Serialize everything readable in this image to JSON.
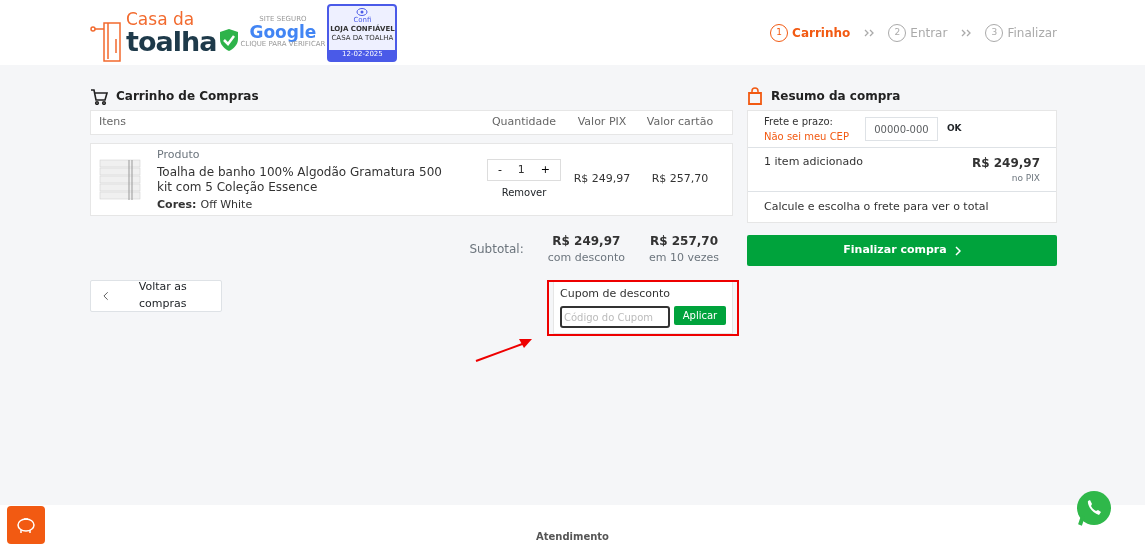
{
  "header": {
    "logo": {
      "line1": "Casa da",
      "line2": "toalha"
    },
    "google_seal": {
      "top": "SITE SEGURO",
      "brand": "Google",
      "bottom": "CLIQUE PARA VERIFICAR"
    },
    "trust_seal": {
      "brand": "Confi",
      "title": "LOJA CONFIÁVEL",
      "store": "CASA DA TOALHA",
      "date": "12-02-2025"
    },
    "steps": [
      {
        "number": "1",
        "label": "Carrinho",
        "selected": true
      },
      {
        "number": "2",
        "label": "Entrar",
        "selected": false
      },
      {
        "number": "3",
        "label": "Finalizar",
        "selected": false
      }
    ]
  },
  "cart": {
    "title": "Carrinho de Compras",
    "columns": [
      "Itens",
      "Quantidade",
      "Valor PIX",
      "Valor cartão"
    ],
    "items": [
      {
        "category": "Produto",
        "name": "Toalha de banho 100% Algodão Gramatura 500 kit com 5 Coleção Essence",
        "colors_label": "Cores:",
        "colors_value": "Off White",
        "decrement": "-",
        "quantity": "1",
        "increment": "+",
        "remove": "Remover",
        "price_pix": "R$ 249,97",
        "price_card": "R$ 257,70"
      }
    ],
    "subtotal": {
      "label": "Subtotal:",
      "pix": "R$ 249,97",
      "pix_note": "com desconto",
      "card": "R$ 257,70",
      "card_note": "em 10 vezes"
    },
    "back_button": "Voltar as compras"
  },
  "coupon": {
    "title": "Cupom de desconto",
    "placeholder": "Código do Cupom",
    "button": "Aplicar"
  },
  "summary": {
    "title": "Resumo da compra",
    "shipping_label": "Frete e prazo:",
    "cep_link": "Não sei meu CEP",
    "cep_placeholder": "00000-000",
    "ok": "OK",
    "items_count": "1 item adicionado",
    "total": "R$ 249,97",
    "total_note": "no PIX",
    "shipping_note": "Calcule e escolha o frete para ver o total",
    "checkout_button": "Finalizar compra"
  },
  "footer": {
    "heading": "Atendimento"
  }
}
